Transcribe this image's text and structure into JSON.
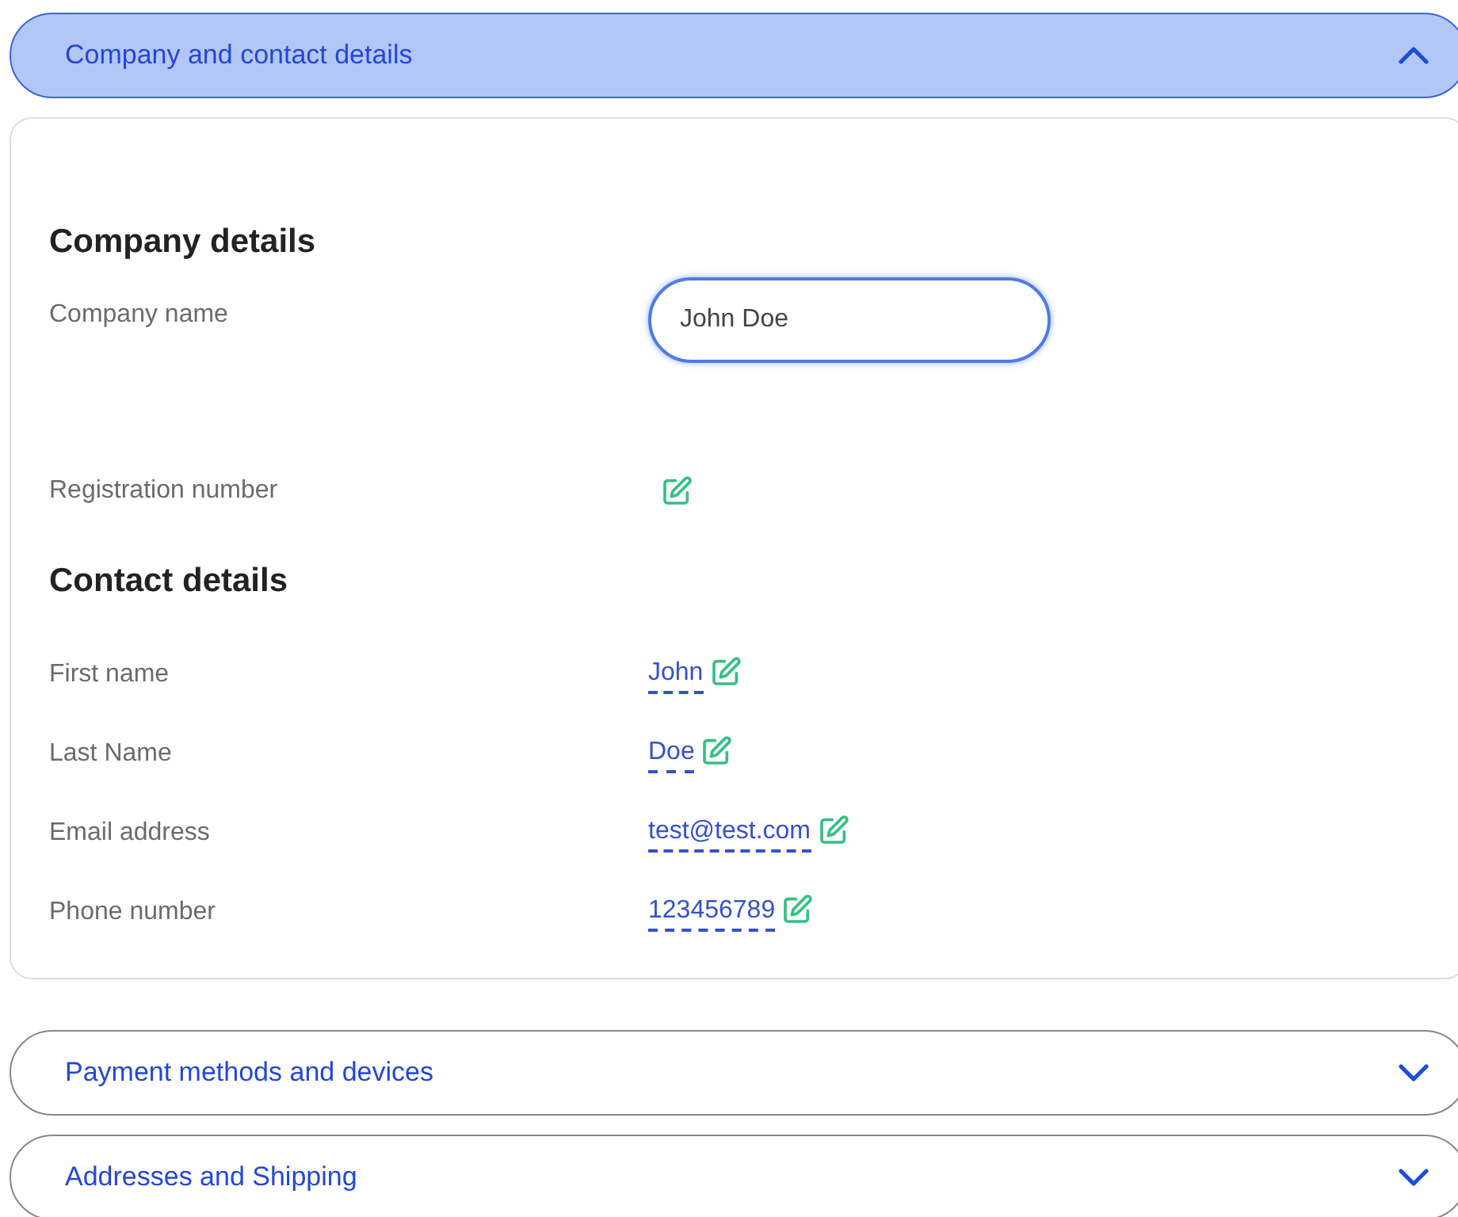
{
  "accordions": [
    {
      "title": "Company and contact details",
      "expanded": true,
      "sections": [
        {
          "heading": "Company details",
          "rows": [
            {
              "kind": "input",
              "label": "Company name",
              "value": "John Doe",
              "focused": true
            },
            {
              "kind": "editable",
              "label": "Registration number"
            }
          ]
        },
        {
          "heading": "Contact details",
          "rows": [
            {
              "kind": "editable",
              "label": "First name",
              "value": "John"
            },
            {
              "kind": "editable",
              "label": "Last Name",
              "value": "Doe"
            },
            {
              "kind": "editable",
              "label": "Email address",
              "value": "test@test.com"
            },
            {
              "kind": "editable",
              "label": "Phone number",
              "value": "123456789"
            }
          ]
        }
      ]
    },
    {
      "title": "Payment methods and devices",
      "expanded": false
    },
    {
      "title": "Addresses and Shipping",
      "expanded": false
    }
  ]
}
